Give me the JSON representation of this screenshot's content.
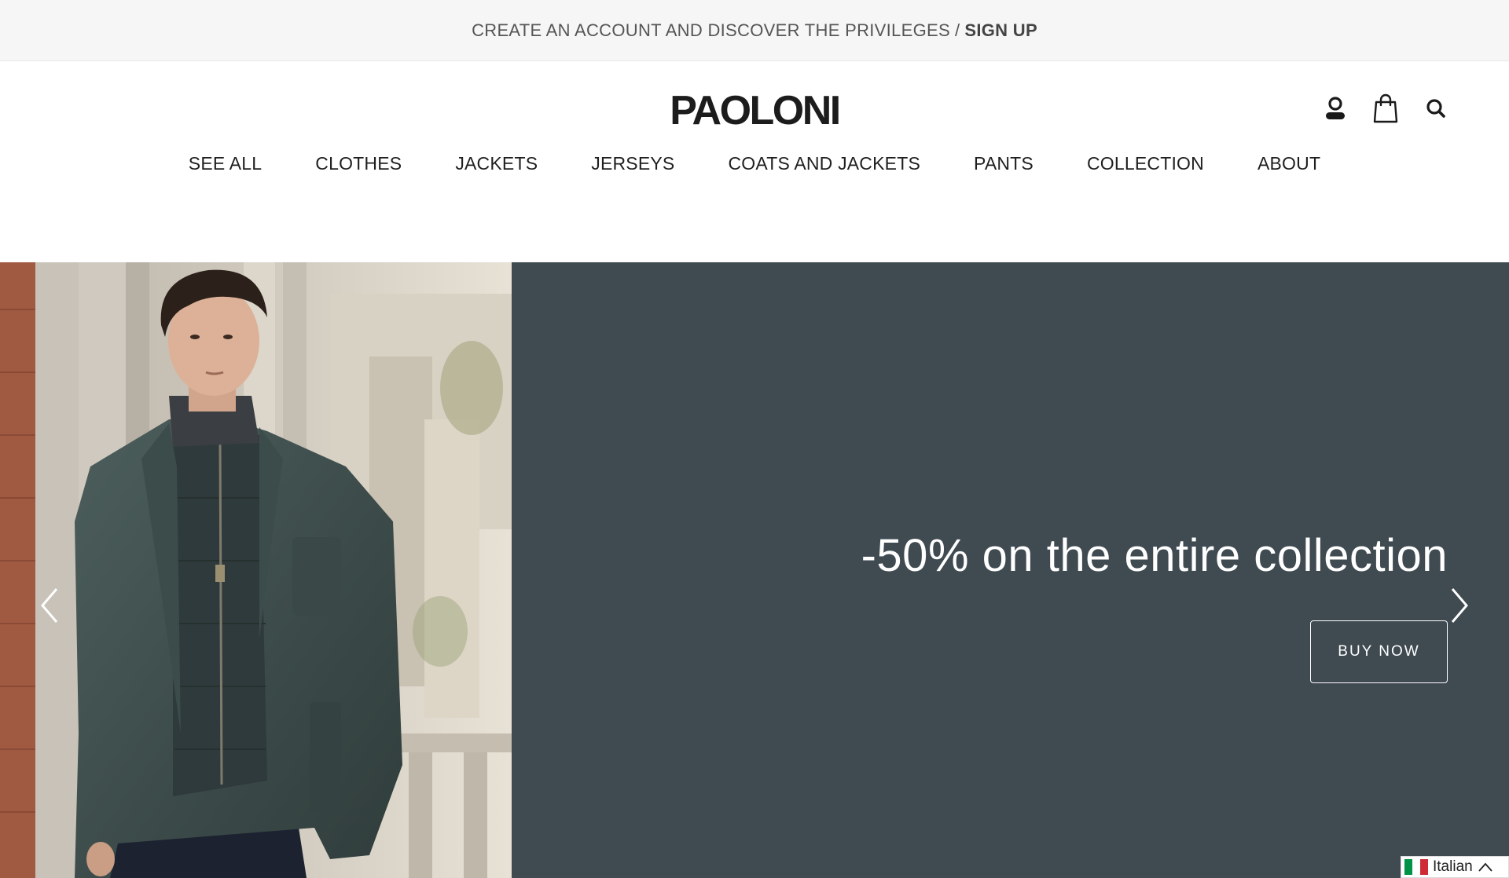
{
  "announcement": {
    "text": "CREATE AN ACCOUNT AND DISCOVER THE PRIVILEGES",
    "separator": "/",
    "cta": "SIGN UP"
  },
  "header": {
    "logo": "PAOLONI",
    "icons": [
      "user-icon",
      "shopping-bag-icon",
      "search-icon"
    ]
  },
  "nav": {
    "items": [
      {
        "label": "SEE ALL"
      },
      {
        "label": "CLOTHES"
      },
      {
        "label": "JACKETS"
      },
      {
        "label": "JERSEYS"
      },
      {
        "label": "COATS AND JACKETS"
      },
      {
        "label": "PANTS"
      },
      {
        "label": "COLLECTION"
      },
      {
        "label": "ABOUT"
      }
    ]
  },
  "hero": {
    "headline": "-50% on the entire collection",
    "button": "BUY NOW",
    "background_color": "#3f4a51"
  },
  "language": {
    "label": "Italian",
    "flag_colors": [
      "#009246",
      "#ffffff",
      "#ce2b37"
    ]
  }
}
